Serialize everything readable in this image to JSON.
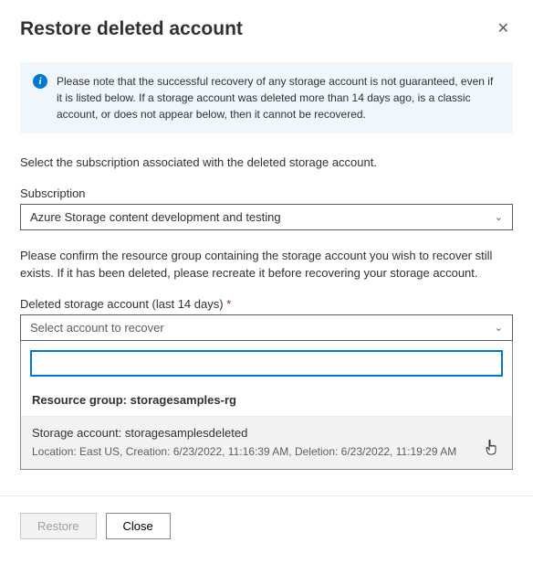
{
  "header": {
    "title": "Restore deleted account"
  },
  "info": {
    "text": "Please note that the successful recovery of any storage account is not guaranteed, even if it is listed below. If a storage account was deleted more than 14 days ago, is a classic account, or does not appear below, then it cannot be recovered."
  },
  "subscription": {
    "intro": "Select the subscription associated with the deleted storage account.",
    "label": "Subscription",
    "value": "Azure Storage content development and testing"
  },
  "confirm_text": "Please confirm the resource group containing the storage account you wish to recover still exists. If it has been deleted, please recreate it before recovering your storage account.",
  "deleted": {
    "label": "Deleted storage account (last 14 days)",
    "placeholder": "Select account to recover",
    "group_header": "Resource group: storagesamples-rg",
    "option_title": "Storage account: storagesamplesdeleted",
    "option_sub": "Location: East US, Creation: 6/23/2022, 11:16:39 AM, Deletion: 6/23/2022, 11:19:29 AM"
  },
  "buttons": {
    "restore": "Restore",
    "close": "Close"
  }
}
